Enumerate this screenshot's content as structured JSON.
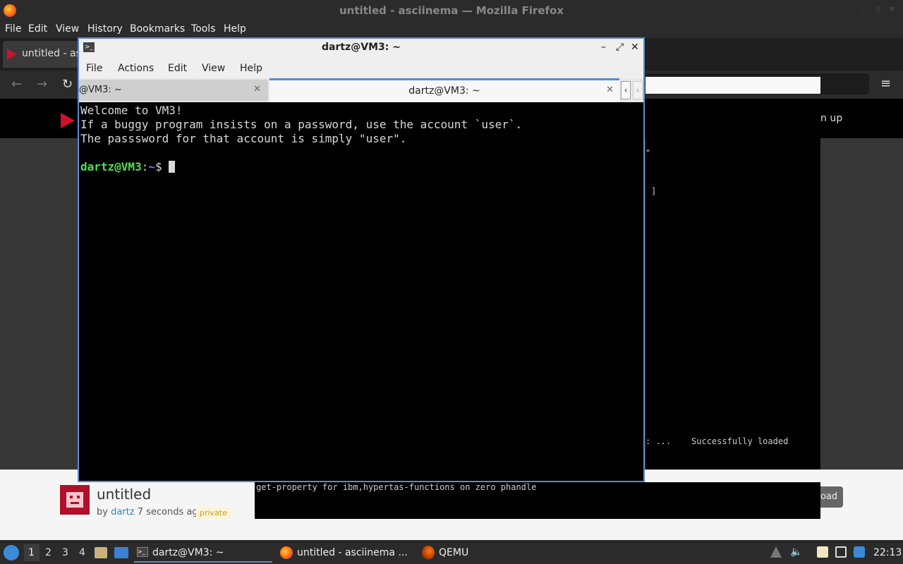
{
  "firefox": {
    "window_title": "untitled - asciinema — Mozilla Firefox",
    "menu": [
      "File",
      "Edit",
      "View",
      "History",
      "Bookmarks",
      "Tools",
      "Help"
    ],
    "tab_title": "untitled - as",
    "menu_button": "≡"
  },
  "page": {
    "header_right": "n up",
    "player_lines": [
      "\"",
      "]",
      ": ...    Successfully loaded"
    ],
    "bottom_term_line": "get-property for ibm,hypertas-functions on zero phandle",
    "recording_title": "untitled",
    "by_prefix": "by",
    "author": "dartz",
    "time_ago": "7 seconds ago",
    "badge": "private",
    "download_label": "oad"
  },
  "terminal": {
    "window_title": "dartz@VM3: ~",
    "menu": [
      "File",
      "Actions",
      "Edit",
      "View",
      "Help"
    ],
    "tabs": [
      {
        "label": "@VM3: ~",
        "active": false
      },
      {
        "label": "dartz@VM3: ~",
        "active": true
      }
    ],
    "output_lines": [
      "Welcome to VM3!",
      "If a buggy program insists on a password, use the account `user`.",
      "The passsword for that account is simply \"user\"."
    ],
    "prompt_user": "dartz@VM3",
    "prompt_sep": ":",
    "prompt_path": "~",
    "prompt_symbol": "$ "
  },
  "taskbar": {
    "workspaces": [
      "1",
      "2",
      "3",
      "4"
    ],
    "tasks": [
      {
        "label": "dartz@VM3: ~",
        "icon": "terminal-icon"
      },
      {
        "label": "untitled - asciinema ...",
        "icon": "firefox-icon"
      },
      {
        "label": "QEMU",
        "icon": "qemu-icon"
      }
    ],
    "clock": "22:13"
  }
}
